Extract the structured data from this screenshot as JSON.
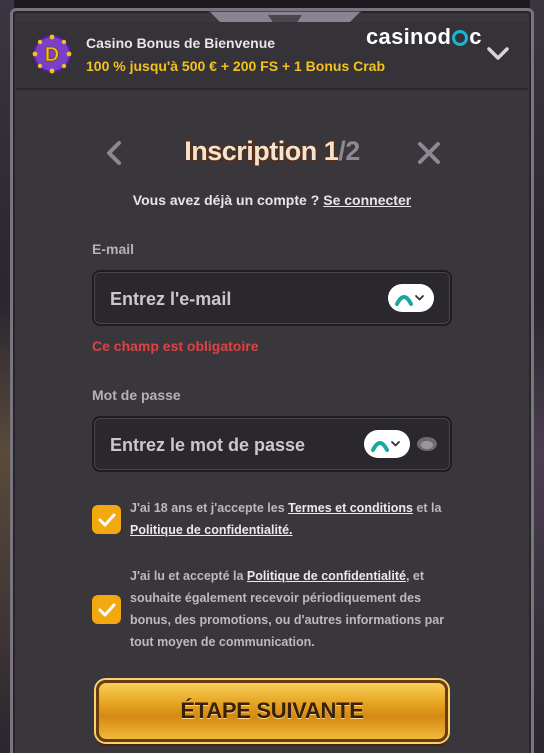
{
  "promo": {
    "title": "Casino Bonus de Bienvenue",
    "offer": "100 % jusqu'à 500 € + 200 FS + 1 Bonus Crab",
    "brand_left": "casinod",
    "brand_right": "c",
    "coin_letter": "D"
  },
  "header": {
    "title_main": "Inscription 1",
    "title_total": "/2",
    "login_prompt": "Vous avez déjà un compte ?",
    "login_link": "Se connecter"
  },
  "email": {
    "label": "E-mail",
    "placeholder": "Entrez l'e-mail",
    "value": "",
    "error": "Ce champ est obligatoire"
  },
  "password": {
    "label": "Mot de passe",
    "placeholder": "Entrez le mot de passe",
    "value": ""
  },
  "consents": {
    "terms": {
      "checked": true,
      "pre": "J'ai 18 ans et j'accepte les ",
      "link1": "Termes et conditions",
      "mid": " et la ",
      "link2": "Politique de confidentialité."
    },
    "marketing": {
      "checked": true,
      "pre": "J'ai lu et accepté la ",
      "link": "Politique de confidentialité",
      "post": ", et souhaite également recevoir périodiquement des bonus, des promotions, ou d'autres informations par tout moyen de communication."
    }
  },
  "cta": {
    "label": "ÉTAPE SUIVANTE"
  },
  "colors": {
    "accent": "#f2a80f",
    "offer": "#f2c21f",
    "error": "#e04242",
    "brand_o": "#19b6d6",
    "pw_manager": "#1aa7a0"
  },
  "icons": [
    "back-chevron-icon",
    "close-icon",
    "chevron-down-icon",
    "password-manager-icon",
    "eye-icon",
    "checkmark-icon",
    "bonus-coin-icon"
  ]
}
